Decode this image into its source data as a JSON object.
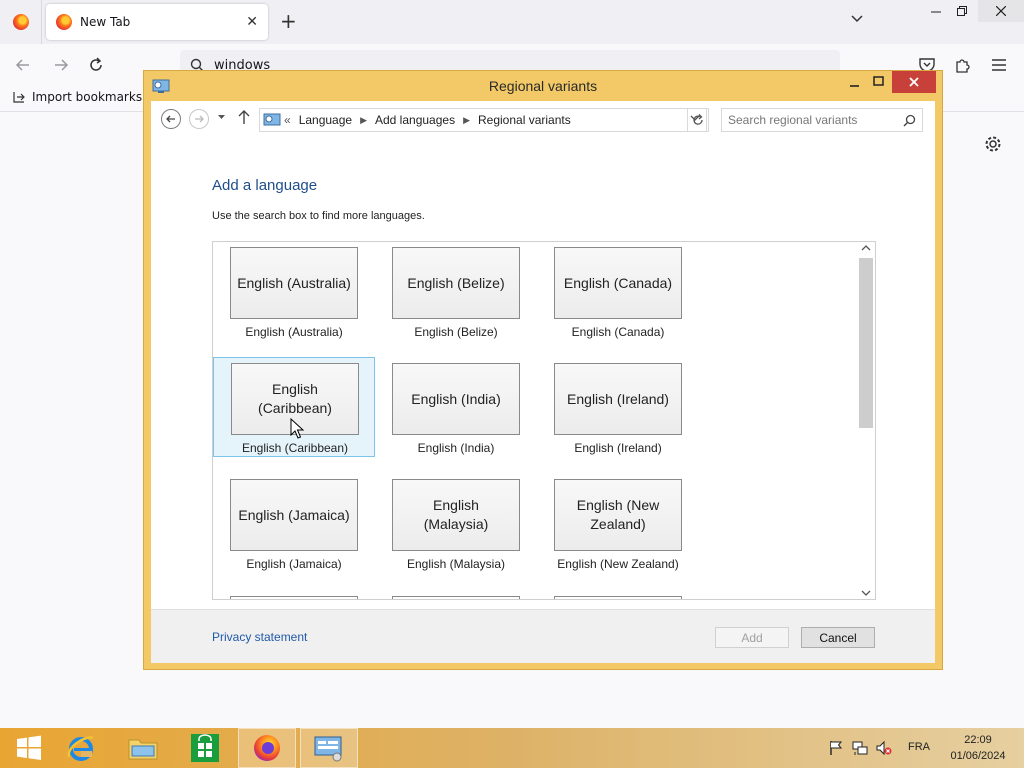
{
  "browser": {
    "tab_title": "New Tab",
    "tab_close": "✕",
    "new_tab": "+",
    "url_text": "windows",
    "bookmark_import": "Import bookmarks..."
  },
  "dialog": {
    "title": "Regional variants",
    "breadcrumb": {
      "prefix": "«",
      "items": [
        "Language",
        "Add languages",
        "Regional variants"
      ]
    },
    "search_placeholder": "Search regional variants",
    "heading": "Add a language",
    "hint": "Use the search box to find more languages.",
    "languages": [
      {
        "tile": "English (Australia)",
        "caption": "English (Australia)"
      },
      {
        "tile": "English (Belize)",
        "caption": "English (Belize)"
      },
      {
        "tile": "English (Canada)",
        "caption": "English (Canada)"
      },
      {
        "tile": "English (Caribbean)",
        "caption": "English (Caribbean)"
      },
      {
        "tile": "English (India)",
        "caption": "English (India)"
      },
      {
        "tile": "English (Ireland)",
        "caption": "English (Ireland)"
      },
      {
        "tile": "English (Jamaica)",
        "caption": "English (Jamaica)"
      },
      {
        "tile": "English (Malaysia)",
        "caption": "English (Malaysia)"
      },
      {
        "tile": "English (New Zealand)",
        "caption": "English (New Zealand)"
      }
    ],
    "selected_language": "English (Caribbean)",
    "privacy_link": "Privacy statement",
    "add_button": "Add",
    "cancel_button": "Cancel"
  },
  "taskbar": {
    "input_language": "FRA",
    "time": "22:09",
    "date": "01/06/2024"
  },
  "colors": {
    "window_frame": "#f2c966",
    "close_button": "#c7403a",
    "heading": "#1f4e8c",
    "link": "#1f5aa8",
    "selection": "#e5f3fb"
  }
}
